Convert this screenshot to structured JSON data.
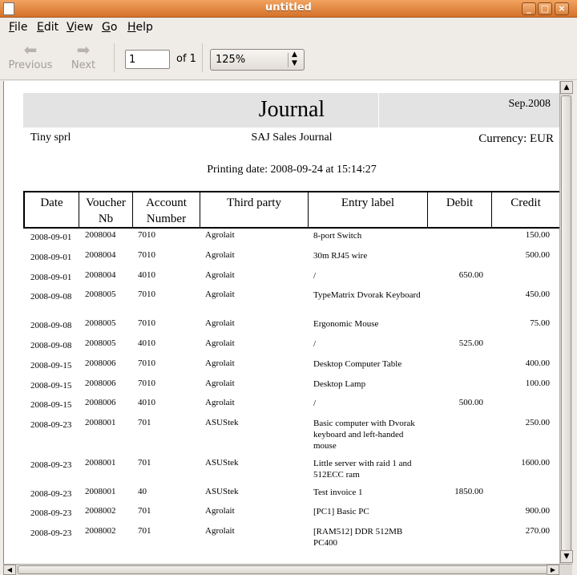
{
  "window": {
    "title": "untitled"
  },
  "menu": [
    {
      "key": "F",
      "rest": "ile"
    },
    {
      "key": "E",
      "rest": "dit"
    },
    {
      "key": "V",
      "rest": "iew"
    },
    {
      "key": "G",
      "rest": "o"
    },
    {
      "key": "H",
      "rest": "elp"
    }
  ],
  "toolbar": {
    "previous_label": "Previous",
    "next_label": "Next",
    "page_value": "1",
    "of_label": "of 1",
    "zoom_value": "125%"
  },
  "report": {
    "title": "Journal",
    "period": "Sep.2008",
    "company": "Tiny sprl",
    "journal": "SAJ Sales Journal",
    "currency": "Currency: EUR",
    "printing_date": "Printing date: 2008-09-24 at 15:14:27",
    "columns": [
      {
        "id": "date",
        "label": "Date"
      },
      {
        "id": "voucher",
        "label": "Voucher\nNb"
      },
      {
        "id": "account",
        "label": "Account\nNumber"
      },
      {
        "id": "partner",
        "label": "Third party"
      },
      {
        "id": "label",
        "label": "Entry label"
      },
      {
        "id": "debit",
        "label": "Debit"
      },
      {
        "id": "credit",
        "label": "Credit"
      }
    ],
    "rows": [
      {
        "date": "2008-09-01",
        "voucher": "2008004",
        "account": "7010",
        "partner": "Agrolait",
        "label": "8-port Switch",
        "debit": "",
        "credit": "150.00"
      },
      {
        "date": "2008-09-01",
        "voucher": "2008004",
        "account": "7010",
        "partner": "Agrolait",
        "label": "30m RJ45 wire",
        "debit": "",
        "credit": "500.00"
      },
      {
        "date": "2008-09-01",
        "voucher": "2008004",
        "account": "4010",
        "partner": "Agrolait",
        "label": "/",
        "debit": "650.00",
        "credit": ""
      },
      {
        "date": "2008-09-08",
        "voucher": "2008005",
        "account": "7010",
        "partner": "Agrolait",
        "label": "TypeMatrix Dvorak Keyboard",
        "debit": "",
        "credit": "450.00"
      },
      {
        "date": "2008-09-08",
        "voucher": "2008005",
        "account": "7010",
        "partner": "Agrolait",
        "label": "Ergonomic Mouse",
        "debit": "",
        "credit": "75.00"
      },
      {
        "date": "2008-09-08",
        "voucher": "2008005",
        "account": "4010",
        "partner": "Agrolait",
        "label": "/",
        "debit": "525.00",
        "credit": ""
      },
      {
        "date": "2008-09-15",
        "voucher": "2008006",
        "account": "7010",
        "partner": "Agrolait",
        "label": "Desktop Computer Table",
        "debit": "",
        "credit": "400.00"
      },
      {
        "date": "2008-09-15",
        "voucher": "2008006",
        "account": "7010",
        "partner": "Agrolait",
        "label": "Desktop Lamp",
        "debit": "",
        "credit": "100.00"
      },
      {
        "date": "2008-09-15",
        "voucher": "2008006",
        "account": "4010",
        "partner": "Agrolait",
        "label": "/",
        "debit": "500.00",
        "credit": ""
      },
      {
        "date": "2008-09-23",
        "voucher": "2008001",
        "account": "701",
        "partner": "ASUStek",
        "label": "Basic computer with Dvorak keyboard and left-handed mouse",
        "debit": "",
        "credit": "250.00"
      },
      {
        "date": "2008-09-23",
        "voucher": "2008001",
        "account": "701",
        "partner": "ASUStek",
        "label": "Little server with raid 1 and 512ECC ram",
        "debit": "",
        "credit": "1600.00"
      },
      {
        "date": "2008-09-23",
        "voucher": "2008001",
        "account": "40",
        "partner": "ASUStek",
        "label": "Test invoice 1",
        "debit": "1850.00",
        "credit": ""
      },
      {
        "date": "2008-09-23",
        "voucher": "2008002",
        "account": "701",
        "partner": "Agrolait",
        "label": "[PC1] Basic PC",
        "debit": "",
        "credit": "900.00"
      },
      {
        "date": "2008-09-23",
        "voucher": "2008002",
        "account": "701",
        "partner": "Agrolait",
        "label": "[RAM512] DDR 512MB PC400",
        "debit": "",
        "credit": "270.00"
      }
    ]
  }
}
